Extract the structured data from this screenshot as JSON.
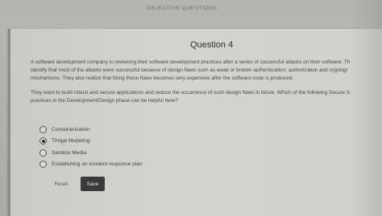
{
  "header": {
    "section_title": "OBJECTIVE QUESTIONS"
  },
  "question": {
    "title": "Question 4",
    "text_lines": [
      "A software development company is reviewing their software development practices after a series of successful attacks on their software. Th",
      "identify that most of the attacks were successful because of design flaws such as weak or broken authentication, authorization and cryptogr",
      "mechanisms. They also realize that fixing these flaws becomes very expensive after the software code is produced."
    ],
    "prompt_lines": [
      "They want to build robust and secure applications and reduce the occurrence of such design flaws in future. Which of the following Secure S",
      "practices in the Development/Design phase can be helpful here?"
    ]
  },
  "options": [
    {
      "label": "Containerization",
      "selected": false
    },
    {
      "label": "Threat Modeling",
      "selected": true
    },
    {
      "label": "Sanitize Media",
      "selected": false
    },
    {
      "label": "Establishing an incident response plan",
      "selected": false
    }
  ],
  "actions": {
    "reset_label": "Reset",
    "save_label": "Save"
  }
}
